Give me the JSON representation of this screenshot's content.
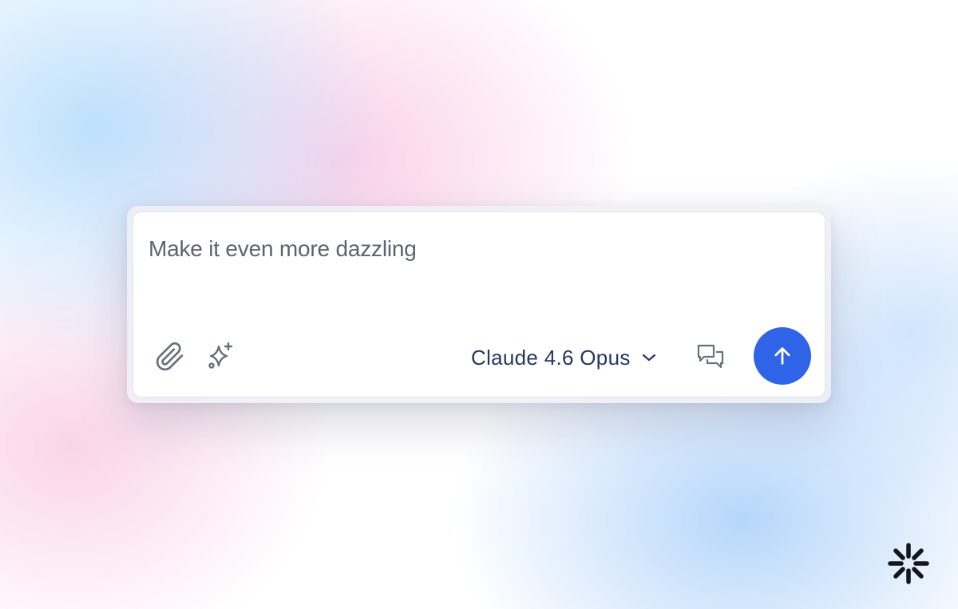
{
  "composer": {
    "prompt_text": "Make it even more dazzling",
    "model_selector": {
      "label": "Claude 4.6 Opus",
      "icon": "chevron-down-icon"
    },
    "icons": {
      "attach": "paperclip-icon",
      "magic": "sparkles-icon",
      "chat": "chat-bubbles-icon",
      "send": "arrow-up-icon"
    }
  },
  "colors": {
    "send_button": "#2f63e8",
    "model_label": "#253660",
    "toolbar_icons": "#6b6f7a",
    "prompt_text": "#5f6270"
  },
  "brand": {
    "icon": "starburst-logo"
  }
}
